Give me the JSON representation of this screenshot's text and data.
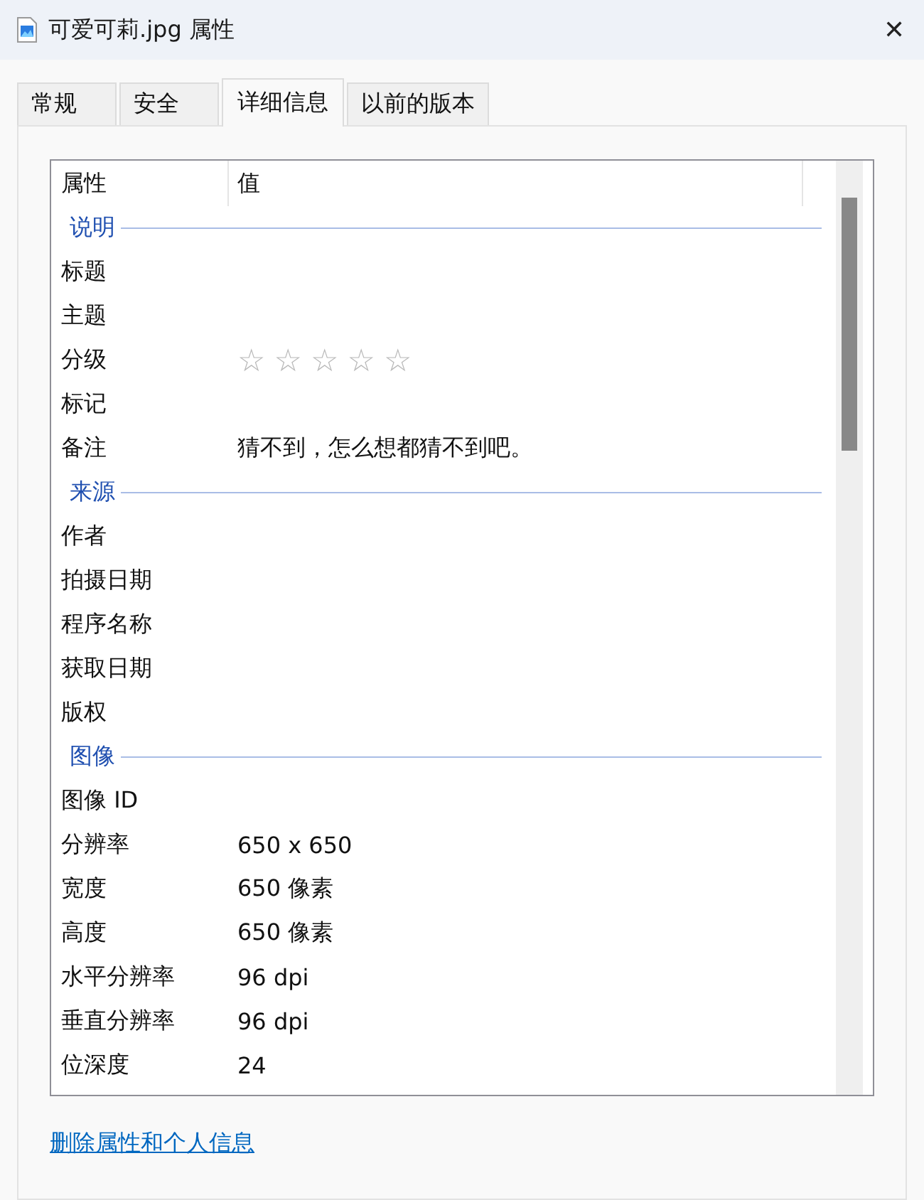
{
  "window": {
    "title": "可爱可莉.jpg 属性",
    "close": "✕"
  },
  "tabs": [
    {
      "label": "常规",
      "selected": false
    },
    {
      "label": "安全",
      "selected": false
    },
    {
      "label": "详细信息",
      "selected": true
    },
    {
      "label": "以前的版本",
      "selected": false
    }
  ],
  "table": {
    "columns": [
      "属性",
      "值"
    ],
    "sections": [
      {
        "title": "说明",
        "rows": [
          {
            "kind": "text",
            "name": "标题"
          },
          {
            "kind": "text",
            "name": "主题"
          },
          {
            "kind": "rating",
            "name": "分级",
            "stars": 0
          },
          {
            "kind": "text",
            "name": "标记"
          },
          {
            "kind": "text",
            "name": "备注",
            "value": "猜不到，怎么想都猜不到吧。"
          }
        ]
      },
      {
        "title": "来源",
        "rows": [
          {
            "kind": "text",
            "name": "作者"
          },
          {
            "kind": "text",
            "name": "拍摄日期"
          },
          {
            "kind": "text",
            "name": "程序名称"
          },
          {
            "kind": "text",
            "name": "获取日期"
          },
          {
            "kind": "text",
            "name": "版权"
          }
        ]
      },
      {
        "title": "图像",
        "rows": [
          {
            "kind": "text",
            "name": "图像 ID"
          },
          {
            "kind": "text",
            "name": "分辨率",
            "value": "650 x 650"
          },
          {
            "kind": "text",
            "name": "宽度",
            "value": "650 像素"
          },
          {
            "kind": "text",
            "name": "高度",
            "value": "650 像素"
          },
          {
            "kind": "text",
            "name": "水平分辨率",
            "value": "96 dpi"
          },
          {
            "kind": "text",
            "name": "垂直分辨率",
            "value": "96 dpi"
          },
          {
            "kind": "text",
            "name": "位深度",
            "value": "24"
          }
        ]
      }
    ]
  },
  "link": "删除属性和个人信息"
}
